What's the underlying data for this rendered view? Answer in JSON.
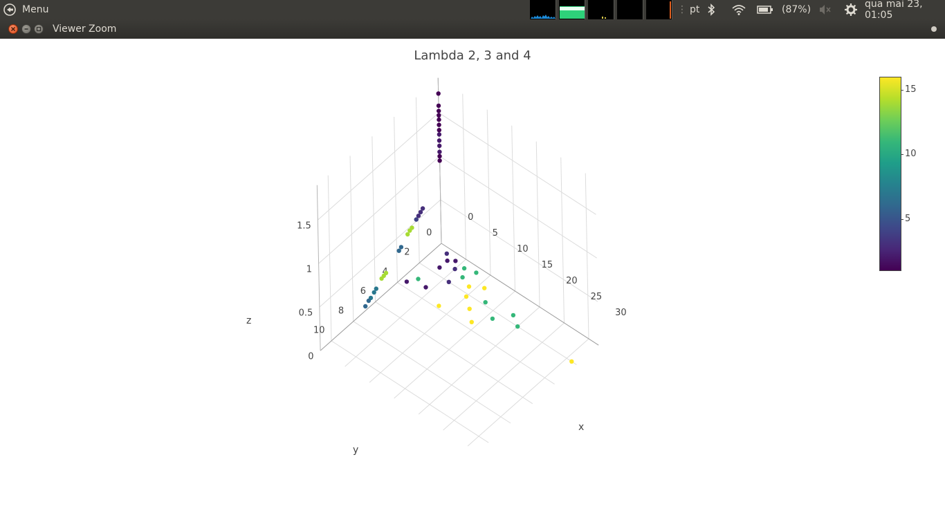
{
  "panel": {
    "menu_label": "Menu",
    "keyboard_layout": "pt",
    "battery": "(87%)",
    "datetime": "qua mai 23, 01:05",
    "icons": [
      "menu-logo-icon",
      "system-monitor-icon",
      "keyboard-layout-icon",
      "bluetooth-icon",
      "wifi-icon",
      "battery-icon",
      "volume-muted-icon",
      "power-gear-icon"
    ]
  },
  "window": {
    "title": "Viewer Zoom",
    "buttons": [
      "close",
      "minimize",
      "maximize"
    ]
  },
  "colors": {
    "panel_bg": "#3c3b37",
    "close_button": "#df4a16"
  },
  "chart_data": {
    "type": "scatter",
    "title": "Lambda 2, 3 and 4",
    "xlabel": "x",
    "ylabel": "y",
    "zlabel": "z",
    "x_ticks": [
      "0",
      "5",
      "10",
      "15",
      "20",
      "25",
      "30"
    ],
    "y_ticks": [
      "0",
      "2",
      "4",
      "6",
      "8",
      "10"
    ],
    "z_ticks": [
      "0",
      "0.5",
      "1",
      "1.5"
    ],
    "xlim": [
      0,
      32
    ],
    "ylim": [
      0,
      11
    ],
    "zlim": [
      0,
      1.9
    ],
    "grid": true,
    "colorscale": "viridis",
    "colorbar": {
      "range": [
        1,
        16
      ],
      "ticks": [
        "5",
        "10",
        "15"
      ],
      "placement": "right"
    },
    "points": [
      {
        "x": 0,
        "y": 0,
        "z": 1.72,
        "c": 1
      },
      {
        "x": 0,
        "y": 0,
        "z": 1.58,
        "c": 1
      },
      {
        "x": 0,
        "y": 0,
        "z": 1.52,
        "c": 1
      },
      {
        "x": 0,
        "y": 0,
        "z": 1.47,
        "c": 1
      },
      {
        "x": 0,
        "y": 0,
        "z": 1.42,
        "c": 1
      },
      {
        "x": 0,
        "y": 0,
        "z": 1.36,
        "c": 1
      },
      {
        "x": 0,
        "y": 0,
        "z": 1.3,
        "c": 1
      },
      {
        "x": 0,
        "y": 0,
        "z": 1.25,
        "c": 2
      },
      {
        "x": 0,
        "y": 0,
        "z": 1.18,
        "c": 2
      },
      {
        "x": 0,
        "y": 0,
        "z": 1.12,
        "c": 2
      },
      {
        "x": 0,
        "y": 0,
        "z": 1.05,
        "c": 2
      },
      {
        "x": 0,
        "y": 0,
        "z": 1.0,
        "c": 1
      },
      {
        "x": 0,
        "y": 0,
        "z": 0.95,
        "c": 1
      },
      {
        "x": 0,
        "y": 1.6,
        "z": 0.58,
        "c": 3
      },
      {
        "x": 0,
        "y": 1.8,
        "z": 0.56,
        "c": 3
      },
      {
        "x": 0,
        "y": 2.0,
        "z": 0.54,
        "c": 3
      },
      {
        "x": 0,
        "y": 2.2,
        "z": 0.52,
        "c": 4
      },
      {
        "x": 0,
        "y": 2.6,
        "z": 0.47,
        "c": 14
      },
      {
        "x": 0,
        "y": 2.8,
        "z": 0.46,
        "c": 14
      },
      {
        "x": 0,
        "y": 3.0,
        "z": 0.44,
        "c": 14
      },
      {
        "x": 0,
        "y": 3.6,
        "z": 0.36,
        "c": 6
      },
      {
        "x": 0,
        "y": 3.8,
        "z": 0.34,
        "c": 6
      },
      {
        "x": 0,
        "y": 5.0,
        "z": 0.22,
        "c": 14
      },
      {
        "x": 0,
        "y": 5.2,
        "z": 0.21,
        "c": 14
      },
      {
        "x": 0,
        "y": 5.4,
        "z": 0.2,
        "c": 14
      },
      {
        "x": 0,
        "y": 5.9,
        "z": 0.14,
        "c": 7
      },
      {
        "x": 0,
        "y": 6.1,
        "z": 0.12,
        "c": 7
      },
      {
        "x": 0,
        "y": 6.4,
        "z": 0.09,
        "c": 7
      },
      {
        "x": 0,
        "y": 6.6,
        "z": 0.08,
        "c": 6
      },
      {
        "x": 0,
        "y": 6.9,
        "z": 0.05,
        "c": 6
      },
      {
        "x": 2,
        "y": 0.4,
        "z": 0,
        "c": 3
      },
      {
        "x": 3,
        "y": 0.8,
        "z": 0,
        "c": 2
      },
      {
        "x": 4,
        "y": 0.5,
        "z": 0,
        "c": 2
      },
      {
        "x": 5,
        "y": 1.0,
        "z": 0,
        "c": 3
      },
      {
        "x": 3,
        "y": 1.5,
        "z": 0,
        "c": 2
      },
      {
        "x": 6,
        "y": 0.6,
        "z": 0,
        "c": 11
      },
      {
        "x": 7,
        "y": 1.2,
        "z": 0,
        "c": 11
      },
      {
        "x": 8,
        "y": 0.4,
        "z": 0,
        "c": 11
      },
      {
        "x": 6,
        "y": 2.0,
        "z": 0,
        "c": 3
      },
      {
        "x": 9,
        "y": 1.5,
        "z": 0,
        "c": 16
      },
      {
        "x": 10,
        "y": 2.2,
        "z": 0,
        "c": 16
      },
      {
        "x": 11,
        "y": 1.0,
        "z": 0,
        "c": 16
      },
      {
        "x": 12,
        "y": 2.8,
        "z": 0,
        "c": 16
      },
      {
        "x": 13,
        "y": 1.8,
        "z": 0,
        "c": 11
      },
      {
        "x": 14,
        "y": 3.5,
        "z": 0,
        "c": 16
      },
      {
        "x": 16,
        "y": 2.5,
        "z": 0,
        "c": 11
      },
      {
        "x": 18,
        "y": 1.5,
        "z": 0,
        "c": 11
      },
      {
        "x": 20,
        "y": 2.0,
        "z": 0,
        "c": 11
      },
      {
        "x": 2,
        "y": 3.0,
        "z": 0,
        "c": 11
      },
      {
        "x": 1,
        "y": 3.6,
        "z": 0,
        "c": 2
      },
      {
        "x": 4,
        "y": 3.2,
        "z": 0,
        "c": 2
      },
      {
        "x": 8,
        "y": 3.8,
        "z": 0,
        "c": 16
      },
      {
        "x": 31,
        "y": 2.0,
        "z": 0,
        "c": 16
      }
    ]
  }
}
